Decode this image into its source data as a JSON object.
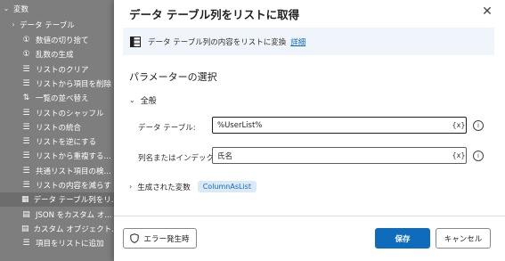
{
  "sidebar": {
    "items": [
      {
        "label": "変数",
        "type": "group",
        "icon": "chevron-down-icon"
      },
      {
        "label": "データ テーブル",
        "type": "group",
        "icon": "chevron-right-icon"
      },
      {
        "label": "数値の切り捨て",
        "type": "item",
        "icon": "number-round-icon"
      },
      {
        "label": "乱数の生成",
        "type": "item",
        "icon": "random-number-icon"
      },
      {
        "label": "リストのクリア",
        "type": "item",
        "icon": "list-clear-icon"
      },
      {
        "label": "リストから項目を削除",
        "type": "item",
        "icon": "list-remove-icon"
      },
      {
        "label": "一覧の並べ替え",
        "type": "item",
        "icon": "sort-icon"
      },
      {
        "label": "リストのシャッフル",
        "type": "item",
        "icon": "shuffle-icon"
      },
      {
        "label": "リストの統合",
        "type": "item",
        "icon": "merge-icon"
      },
      {
        "label": "リストを逆にする",
        "type": "item",
        "icon": "reverse-icon"
      },
      {
        "label": "リストから重複する...",
        "type": "item",
        "icon": "dedupe-icon"
      },
      {
        "label": "共通リスト項目の検...",
        "type": "item",
        "icon": "common-items-icon"
      },
      {
        "label": "リストの内容を減らす",
        "type": "item",
        "icon": "subtract-icon"
      },
      {
        "label": "データ テーブル列をリ...",
        "type": "item",
        "icon": "table-column-icon",
        "selected": true
      },
      {
        "label": "JSON をカスタム オ...",
        "type": "item",
        "icon": "json-icon"
      },
      {
        "label": "カスタム オブジェクト...",
        "type": "item",
        "icon": "object-icon"
      },
      {
        "label": "項目をリストに追加",
        "type": "item",
        "icon": "list-add-icon"
      }
    ]
  },
  "dialog": {
    "title": "データ テーブル列をリストに取得",
    "description": "データ テーブル列の内容をリストに変換",
    "details_link": "詳細",
    "section_title": "パラメーターの選択",
    "group_general": "全般",
    "fields": {
      "datatable": {
        "label": "データ テーブル:",
        "value": "%UserList%"
      },
      "column": {
        "label": "列名またはインデックス:",
        "value": "氏名"
      }
    },
    "fx_label": "{x}",
    "info_glyph": "i",
    "generated_vars_label": "生成された変数",
    "generated_var": "ColumnAsList",
    "buttons": {
      "on_error": "エラー発生時",
      "save": "保存",
      "cancel": "キャンセル"
    },
    "close_glyph": "✕"
  },
  "colors": {
    "accent": "#0f6cbd",
    "sidebar_bg": "#7e7e7e",
    "info_bar_bg": "#f0f4fb"
  }
}
